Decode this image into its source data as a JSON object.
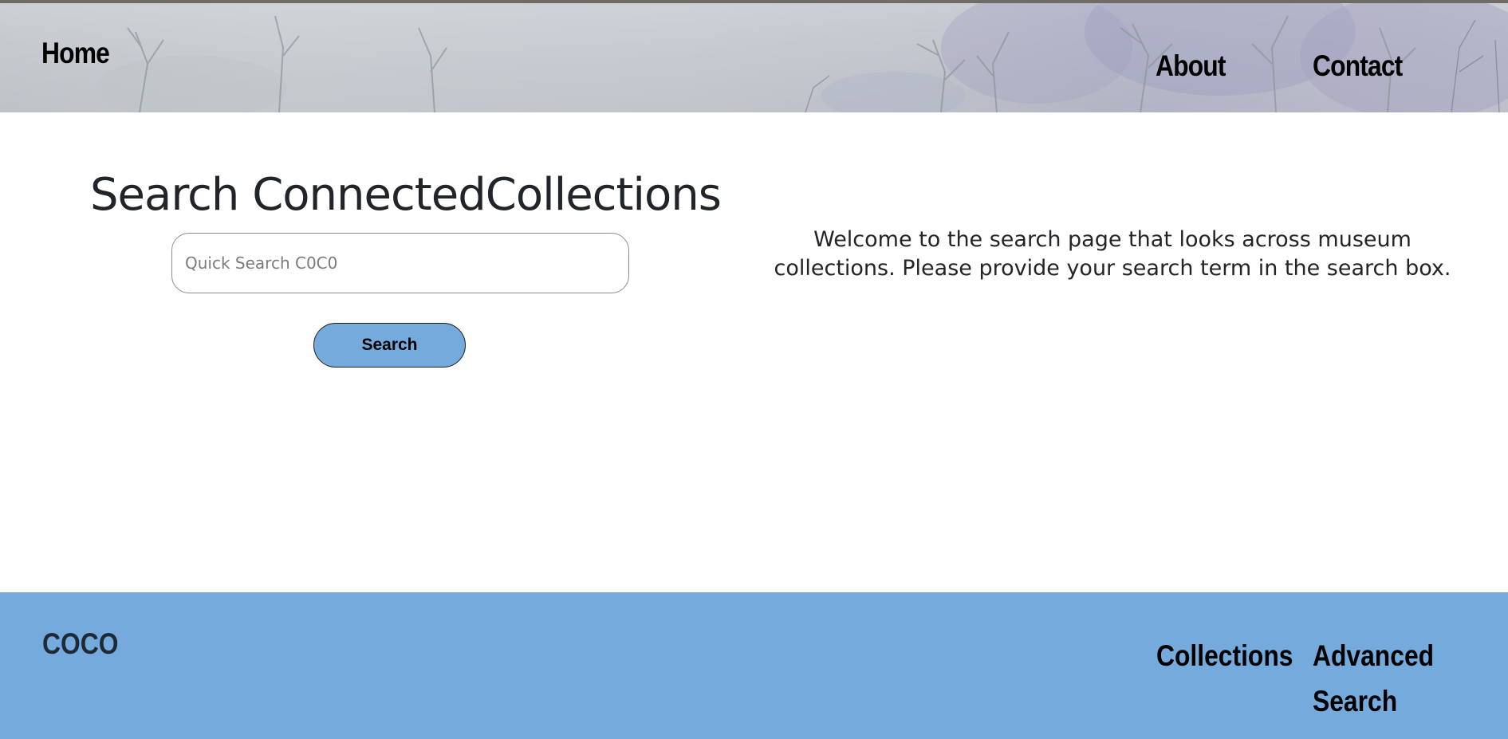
{
  "header": {
    "nav_home": "Home",
    "nav_about": "About",
    "nav_contact": "Contact"
  },
  "main": {
    "title": "Search ConnectedCollections",
    "search_placeholder": "Quick Search C0C0",
    "search_value": "",
    "search_button": "Search",
    "welcome_text": "Welcome to the search page that looks across museum collections. Please provide your search term in the search box."
  },
  "footer": {
    "brand": "COCO",
    "collections": "Collections",
    "advanced_search": "Advanced Search"
  },
  "colors": {
    "accent": "#75aadd",
    "text": "#212529",
    "button_border": "#1d1d1d"
  },
  "icons": {
    "header_background": "winter-painting-banner"
  }
}
